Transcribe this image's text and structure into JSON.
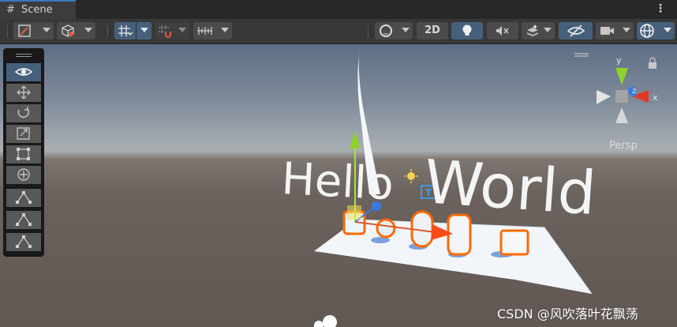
{
  "tab": {
    "icon": "grid-icon",
    "title": "Scene"
  },
  "toolbar": {
    "left_groups": [
      "draw-mode-icon",
      "shading-cube-icon",
      "grid-snap-icon",
      "snap-settings-icon",
      "increment-snap-icon"
    ],
    "right": {
      "render_mode_icon": "sphere-icon",
      "mode_2d_label": "2D",
      "lighting_icon": "lightbulb-icon",
      "audio_icon": "audio-mute-icon",
      "effects_icon": "effects-icon",
      "visibility_icon": "eye-slash-icon",
      "camera_icon": "camera-icon",
      "gizmos_icon": "gizmo-globe-icon"
    }
  },
  "tools": [
    "view-tool-icon",
    "move-tool-icon",
    "rotate-tool-icon",
    "scale-tool-icon",
    "rect-tool-icon",
    "transform-tool-icon",
    "custom-tool-1-icon",
    "custom-tool-2-icon",
    "custom-tool-3-icon"
  ],
  "scene": {
    "hello_text": "Hello",
    "world_text": "World",
    "projection_label": "Persp",
    "axis_labels": {
      "y": "y",
      "x": "x",
      "z": "z"
    },
    "text_icon_label": "T"
  },
  "colors": {
    "selection_outline": "#ff6a00",
    "accent_blue": "#3a79bb",
    "axis_x": "#e03a2a",
    "axis_y": "#8ed12a",
    "axis_z": "#3a7ae0"
  },
  "watermark": "CSDN @风吹落叶花飘荡"
}
